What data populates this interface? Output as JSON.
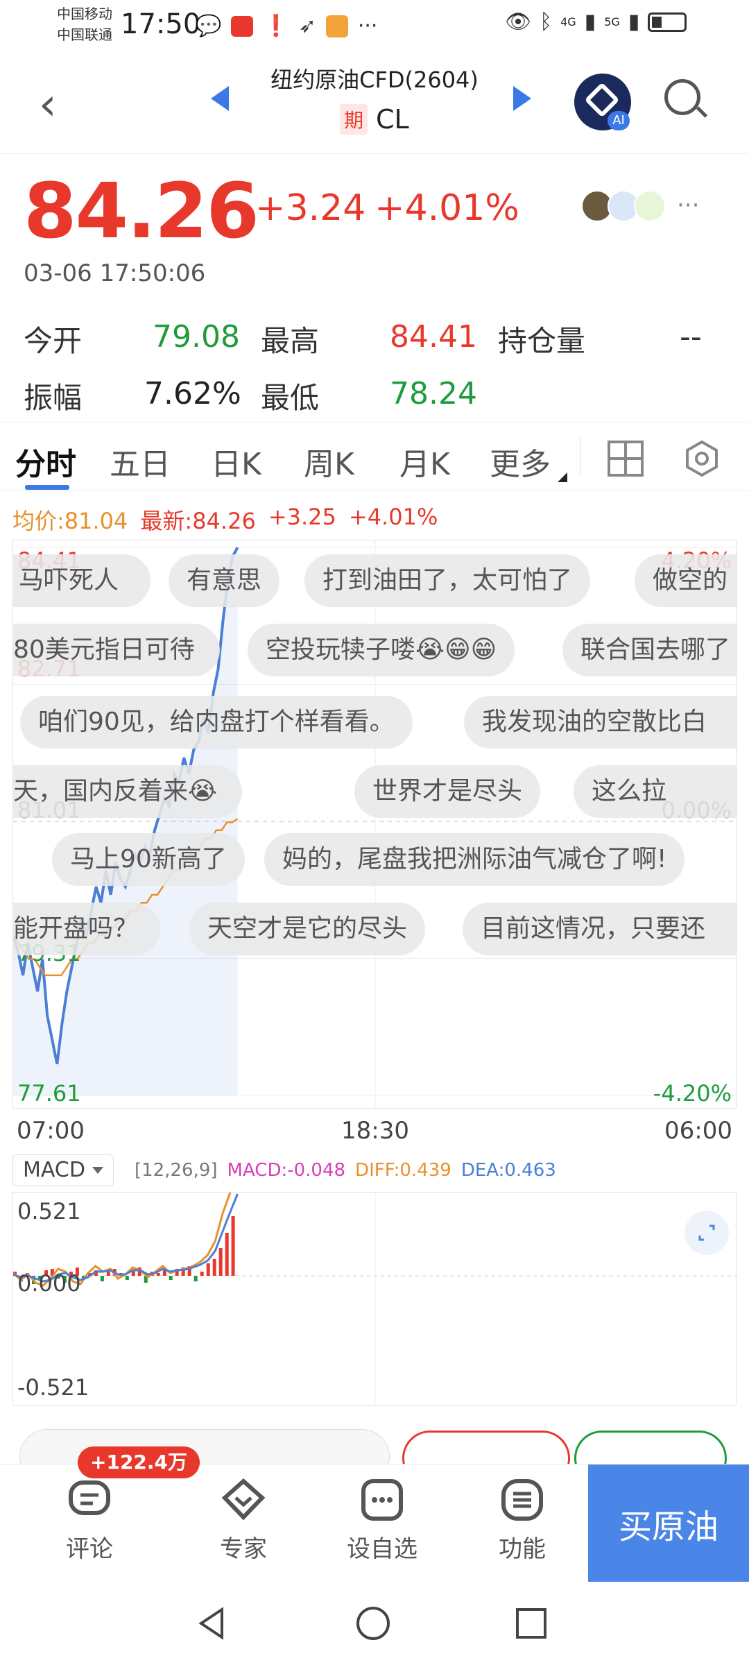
{
  "status_bar": {
    "carrier1": "中国移动",
    "carrier2": "中国联通",
    "time": "17:50",
    "signal1": "4G",
    "signal2": "5G"
  },
  "nav": {
    "title": "纽约原油CFD(2604)",
    "badge": "期",
    "code": "CL",
    "ai_label": "AI"
  },
  "quote": {
    "price": "84.26",
    "change": "+3.24",
    "change_pct": "+4.01%",
    "timestamp": "03-06 17:50:06",
    "more": "···"
  },
  "stats": {
    "open_label": "今开",
    "open": "79.08",
    "high_label": "最高",
    "high": "84.41",
    "oi_label": "持仓量",
    "oi": "--",
    "amp_label": "振幅",
    "amp": "7.62%",
    "low_label": "最低",
    "low": "78.24"
  },
  "tabs": [
    "分时",
    "五日",
    "日K",
    "周K",
    "月K",
    "更多"
  ],
  "legend": {
    "avg": "均价:81.04",
    "latest": "最新:84.26",
    "chg": "+3.25",
    "pct": "+4.01%"
  },
  "chart_data": {
    "type": "line",
    "title": "",
    "x_ticks": [
      "07:00",
      "18:30",
      "06:00"
    ],
    "y_ticks_left": [
      "84.41",
      "82.71",
      "81.01",
      "79.31",
      "77.61"
    ],
    "y_ticks_right": [
      "4.20%",
      "0.00%",
      "-4.20%"
    ],
    "ylim": [
      77.61,
      84.41
    ],
    "series": [
      {
        "values": [
          79.6,
          79.4,
          79.1,
          79.5,
          79.2,
          78.9,
          79.3,
          78.6,
          78.3,
          78.0,
          78.5,
          78.9,
          79.2,
          79.5,
          79.8,
          79.6,
          79.9,
          80.2,
          80.0,
          80.4,
          80.1,
          80.5,
          80.3,
          80.2,
          80.4,
          80.6,
          80.5,
          80.7,
          80.6,
          80.9,
          81.1,
          81.3,
          81.2,
          81.6,
          81.5,
          81.8,
          81.6,
          81.9,
          82.0,
          82.3,
          82.1,
          82.6,
          82.9,
          83.5,
          84.0,
          84.3,
          84.41
        ]
      },
      {
        "values": [
          79.6,
          79.5,
          79.4,
          79.3,
          79.3,
          79.2,
          79.1,
          79.1,
          79.1,
          79.1,
          79.2,
          79.3,
          79.3,
          79.4,
          79.5,
          79.5,
          79.6,
          79.6,
          79.7,
          79.7,
          79.8,
          79.8,
          79.9,
          79.9,
          80.0,
          80.0,
          80.1,
          80.1,
          80.2,
          80.3,
          80.4,
          80.4,
          80.5,
          80.6,
          80.6,
          80.7,
          80.8,
          80.8,
          80.9,
          80.9,
          81.0,
          81.0,
          81.04
        ]
      }
    ]
  },
  "danmu": [
    "马吓死人",
    "有意思",
    "打到油田了，太可怕了",
    "做空的",
    "80美元指日可待",
    "空投玩犊子喽😭😁😁",
    "联合国去哪了",
    "咱们90见，给内盘打个样看看。",
    "我发现油的空散比白",
    "天，国内反着来😭",
    "世界才是尽头",
    "这么拉",
    "马上90新高了",
    "妈的，尾盘我把洲际油气减仓了啊!",
    "能开盘吗？",
    "天空才是它的尽头",
    "目前这情况，只要还"
  ],
  "macd": {
    "indicator": "MACD",
    "params": "[12,26,9]",
    "macd": "MACD:-0.048",
    "diff": "DIFF:0.439",
    "dea": "DEA:0.463",
    "y_top": "0.521",
    "y_mid": "0.000",
    "y_bottom": "-0.521"
  },
  "bottom": {
    "comment_badge": "+122.4万",
    "comment": "评论",
    "expert": "专家",
    "watch": "设自选",
    "func": "功能",
    "buy": "买原油"
  },
  "colors": {
    "up": "#e8382c",
    "down": "#1f9b3b",
    "accent": "#4a86e8",
    "price_line": "#4a7fd4",
    "avg_line": "#e8902c"
  }
}
